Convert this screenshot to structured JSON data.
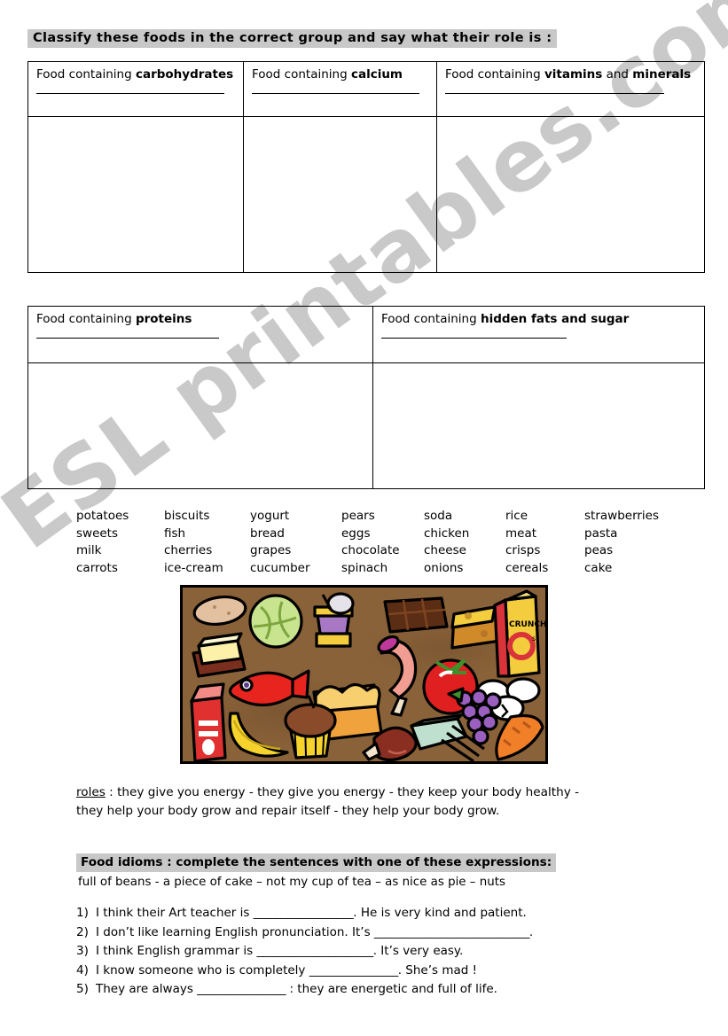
{
  "watermark": {
    "text": "ESL printables.com"
  },
  "title": {
    "text": "Classify these foods in the correct group and say what their role is :"
  },
  "table1": {
    "cells": [
      {
        "prefix": "Food containing ",
        "bold": "carbohydrates",
        "suffix": ""
      },
      {
        "prefix": "Food containing ",
        "bold": "calcium",
        "suffix": ""
      },
      {
        "prefix": "Food containing ",
        "bold": "vitamins",
        "mid": " and ",
        "bold2": "minerals",
        "suffix": ""
      }
    ]
  },
  "table2": {
    "cells": [
      {
        "prefix": "Food containing ",
        "bold": "proteins",
        "suffix": ""
      },
      {
        "prefix": "Food containing ",
        "bold": "hidden fats and sugar",
        "suffix": ""
      }
    ]
  },
  "word_bank": {
    "columns": [
      [
        "potatoes",
        "sweets",
        "milk",
        "carrots"
      ],
      [
        "biscuits",
        "fish",
        "cherries",
        "ice-cream"
      ],
      [
        "yogurt",
        "bread",
        "grapes",
        "cucumber"
      ],
      [
        "pears",
        "eggs",
        "chocolate",
        "spinach"
      ],
      [
        "soda",
        "chicken",
        "cheese",
        "onions"
      ],
      [
        "rice",
        "meat",
        "crisps",
        "cereals"
      ],
      [
        "strawberries",
        "pasta",
        "peas",
        "cake"
      ]
    ],
    "flat": [
      "potatoes",
      "biscuits",
      "yogurt",
      "pears",
      "soda",
      "rice",
      "strawberries",
      "sweets",
      "fish",
      "bread",
      "eggs",
      "chicken",
      "meat",
      "pasta",
      "milk",
      "cherries",
      "grapes",
      "chocolate",
      "cheese",
      "crisps",
      "peas",
      "carrots",
      "ice-cream",
      "cucumber",
      "spinach",
      "onions",
      "cereals",
      "cake"
    ]
  },
  "illustration": {
    "alt": "Assortment of food items on a brown table",
    "cereal_box_label": "CRUNCHY",
    "cereal_box_label2": "O",
    "cereal_box_label3": "s",
    "items": [
      "potato",
      "cabbage",
      "yogurt-pot",
      "chocolate-bar",
      "cheese-wedge",
      "cereal-box",
      "butter",
      "fish",
      "ham-slice",
      "tomato",
      "eggs",
      "milk-carton",
      "banana",
      "cupcake",
      "bread-loaf",
      "chicken-leg",
      "asparagus",
      "grapes",
      "carrot"
    ],
    "background_color": "#8a6239"
  },
  "roles": {
    "label": "roles",
    "line1": " : they give you energy    -   they give you energy - they  keep your body healthy   -",
    "line2": "they help your body grow and repair itself    -   they help your body grow."
  },
  "idioms": {
    "heading": "Food idioms : complete the sentences with one of these expressions:",
    "expressions": "full of beans -  a piece of cake –  not my cup of tea –  as nice as pie  –  nuts",
    "sentences": [
      {
        "num": "1)",
        "before": "I think their Art teacher is ",
        "blank": "__________________",
        "after": ". He is very kind and patient."
      },
      {
        "num": "2)",
        "before": "I don’t like learning English pronunciation. It’s ",
        "blank": "____________________________",
        "after": "."
      },
      {
        "num": "3)",
        "before": "I think English grammar is ",
        "blank": "_____________________",
        "after": ". It’s very easy."
      },
      {
        "num": "4)",
        "before": "I know someone who is completely ",
        "blank": "________________",
        "after": ". She’s mad !"
      },
      {
        "num": "5)",
        "before": "They are always ",
        "blank": "________________",
        "after": " : they are energetic and full of life."
      }
    ]
  },
  "colors": {
    "highlight": "#c8c8c8",
    "watermark": "#c9c9c9",
    "ink": "#000000"
  }
}
